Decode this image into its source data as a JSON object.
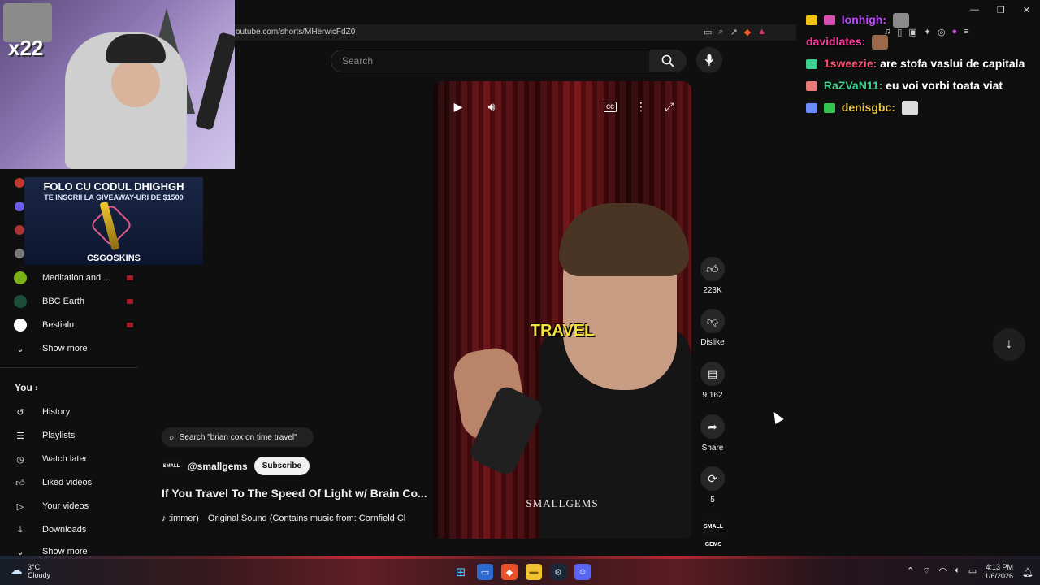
{
  "browser": {
    "url": "outube.com/shorts/MHerwicFdZ0"
  },
  "stream": {
    "overlay_tag": "x22"
  },
  "promo": {
    "line1": "FOLO CU CODUL DHIGHGH",
    "line2": "TE INSCRII LA GIVEAWAY-URI DE $1500",
    "brand": "CSGOSKINS"
  },
  "sidebar": {
    "channels": [
      {
        "label": "Meditation and ...",
        "color": "#7ab317"
      },
      {
        "label": "BBC Earth",
        "color": "#1c4f3a"
      },
      {
        "label": "Bestialu",
        "color": "#ffffff"
      }
    ],
    "show_more_1": "Show more",
    "you_label": "You",
    "you_items": [
      {
        "label": "History",
        "icon": "history-icon"
      },
      {
        "label": "Playlists",
        "icon": "playlists-icon"
      },
      {
        "label": "Watch later",
        "icon": "watch-later-icon"
      },
      {
        "label": "Liked videos",
        "icon": "thumb-up-icon"
      },
      {
        "label": "Your videos",
        "icon": "your-videos-icon"
      },
      {
        "label": "Downloads",
        "icon": "download-icon"
      }
    ],
    "show_more_2": "Show more"
  },
  "search": {
    "placeholder": "Search"
  },
  "video": {
    "caption": "TRAVEL",
    "watermark": "SMALLGEMS"
  },
  "actions": {
    "likes": "223K",
    "dislike_label": "Dislike",
    "comments": "9,162",
    "share_label": "Share",
    "remix_count": "5",
    "channel_thumb": "SMALL GEMS"
  },
  "info": {
    "search_suggestion": "Search \"brian cox on time travel\"",
    "channel_handle": "@smallgems",
    "subscribe_label": "Subscribe",
    "title": "If You Travel To The Speed Of Light w/ Brain Co...",
    "sound_prefix": ":immer)",
    "sound_text": "Original Sound (Contains music from: Cornfield Cl"
  },
  "chat": {
    "messages": [
      {
        "user": "Ionhigh:",
        "user_color": "#c04bff",
        "text": ""
      },
      {
        "user": "davidlates:",
        "user_color": "#ff3ba0",
        "text": ""
      },
      {
        "user": "1sweezie:",
        "user_color": "#ff4d6d",
        "text": "are stofa vaslui de capitala"
      },
      {
        "user": "RaZVaN11:",
        "user_color": "#3ecf8e",
        "text": "eu voi vorbi toata viat"
      },
      {
        "user": "denisgbc:",
        "user_color": "#e6c84a",
        "text": ""
      }
    ]
  },
  "taskbar": {
    "temp": "3°C",
    "weather": "Cloudy",
    "time": "4:13 PM",
    "date": "1/6/2026"
  }
}
